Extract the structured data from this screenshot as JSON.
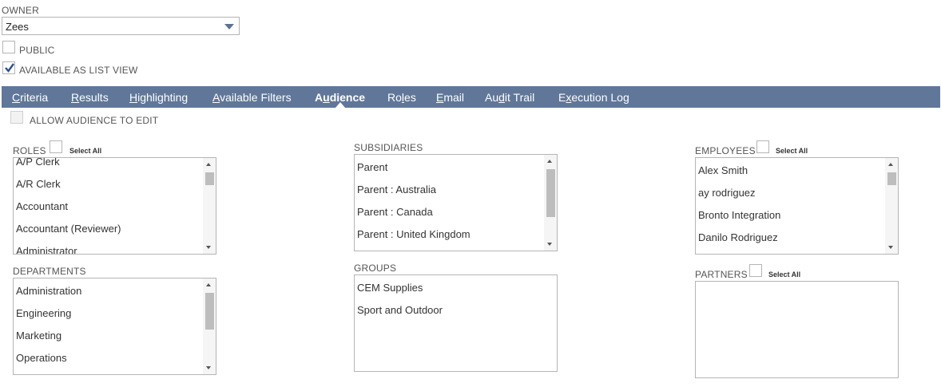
{
  "owner": {
    "label": "OWNER",
    "value": "Zees"
  },
  "public_label": "PUBLIC",
  "list_view_label": "AVAILABLE AS LIST VIEW",
  "tabs": [
    {
      "pre": "",
      "u": "C",
      "post": "riteria"
    },
    {
      "pre": "",
      "u": "R",
      "post": "esults"
    },
    {
      "pre": "",
      "u": "H",
      "post": "ighlighting"
    },
    {
      "pre": "",
      "u": "A",
      "post": "vailable Filters"
    },
    {
      "pre": "A",
      "u": "u",
      "post": "dience"
    },
    {
      "pre": "Ro",
      "u": "l",
      "post": "es"
    },
    {
      "pre": "",
      "u": "E",
      "post": "mail"
    },
    {
      "pre": "Au",
      "u": "d",
      "post": "it Trail"
    },
    {
      "pre": "E",
      "u": "x",
      "post": "ecution Log"
    }
  ],
  "allow_edit_label": "ALLOW AUDIENCE TO EDIT",
  "select_all": "Select All",
  "roles": {
    "label": "ROLES",
    "items": [
      "A/P Clerk",
      "A/R Clerk",
      "Accountant",
      "Accountant (Reviewer)",
      "Administrator"
    ]
  },
  "subsidiaries": {
    "label": "SUBSIDIARIES",
    "items": [
      "Parent",
      "Parent : Australia",
      "Parent : Canada",
      "Parent : United Kingdom"
    ]
  },
  "employees": {
    "label": "EMPLOYEES",
    "items": [
      "Alex Smith",
      "ay rodriguez",
      "Bronto Integration",
      "Danilo Rodriguez"
    ]
  },
  "departments": {
    "label": "DEPARTMENTS",
    "items": [
      "Administration",
      "Engineering",
      "Marketing",
      "Operations"
    ]
  },
  "groups": {
    "label": "GROUPS",
    "items": [
      "CEM Supplies",
      "Sport and Outdoor"
    ]
  },
  "partners": {
    "label": "PARTNERS",
    "items": []
  }
}
